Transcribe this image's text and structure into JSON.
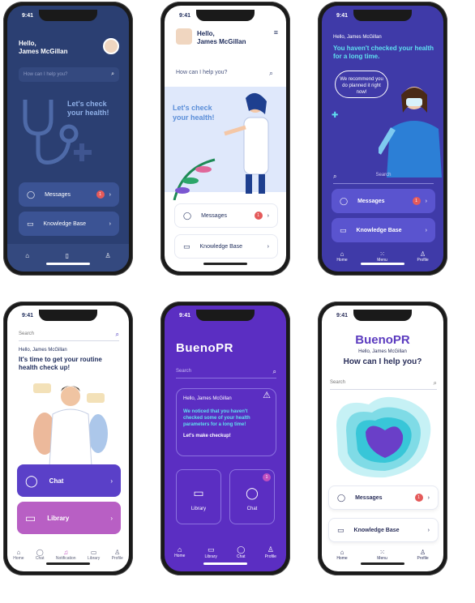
{
  "status": {
    "time": "9:41"
  },
  "greeting": {
    "hello": "Hello,",
    "name": "James McGillan",
    "full": "Hello, James McGillan"
  },
  "search": {
    "placeholder_a": "How can I help you?",
    "placeholder_b": "Search"
  },
  "hero": {
    "check": "Let's check your health!"
  },
  "menu": {
    "messages": "Messages",
    "knowledge": "Knowledge Base",
    "chat": "Chat",
    "library": "Library",
    "badge": "1"
  },
  "phone3": {
    "headline": "You haven't checked your health for a long time.",
    "bubble": "We recommend you do planned it right now!"
  },
  "phone4": {
    "headline": "It's time to get your routine health check up!"
  },
  "phone5": {
    "notice": "We noticed that you haven't checked some of your health parameters for a long time!",
    "cta": "Let's make checkup!"
  },
  "brand": {
    "logo": "BuenoPR"
  },
  "phone6": {
    "question": "How can I help you?"
  },
  "nav": {
    "home": "Home",
    "menu": "Menu",
    "profile": "Profile",
    "chat": "Chat",
    "notification": "Notification",
    "library": "Library"
  },
  "colors": {
    "navy": "#2b3f72",
    "white": "#ffffff",
    "purple": "#4b3bbf",
    "violet": "#5b2ec2",
    "indigo": "#3f3aa8",
    "pink": "#e45a5a",
    "teal": "#38c6d8"
  }
}
